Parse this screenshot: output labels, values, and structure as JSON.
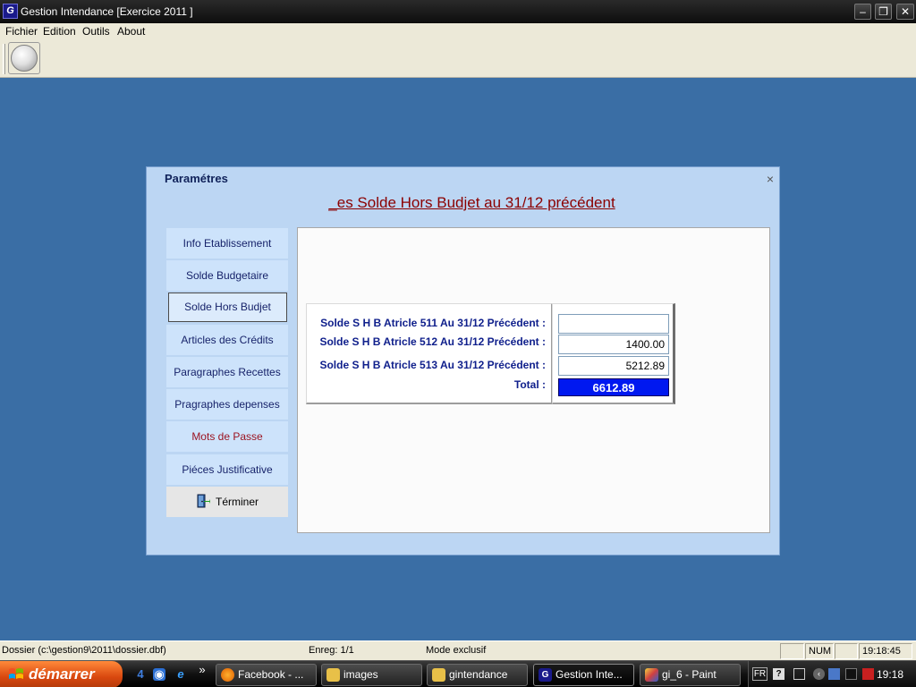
{
  "window": {
    "app_icon_letter": "G",
    "title": "Gestion Intendance [Exercice  2011 ]"
  },
  "menu": [
    "Fichier",
    "Edition",
    "Outils",
    "About"
  ],
  "dialog": {
    "title": "Paramétres",
    "close": "×",
    "heading": "_es Solde  Hors  Budjet  au 31/12   précédent",
    "nav": [
      {
        "label": "Info  Etablissement"
      },
      {
        "label": "Solde  Budgetaire"
      },
      {
        "label": "Solde  Hors  Budjet"
      },
      {
        "label": "Articles des Crédits"
      },
      {
        "label": "Paragraphes Recettes"
      },
      {
        "label": "Pragraphes  depenses"
      },
      {
        "label": "Mots de Passe"
      },
      {
        "label": "Piéces Justificative"
      },
      {
        "label": "Términer"
      }
    ],
    "active_nav": "Solde  Hors  Budjet",
    "fields": [
      {
        "label": "Solde S H B Atricle 511  Au 31/12 Précédent :",
        "value": ""
      },
      {
        "label": "Solde S H B Atricle 512  Au 31/12 Précédent :",
        "value": "1400.00"
      },
      {
        "label": "Solde S H B Atricle 513  Au 31/12 Précédent :",
        "value": "5212.89"
      }
    ],
    "total": {
      "label": "Total  :",
      "value": "6612.89"
    }
  },
  "statusbar": {
    "path": "Dossier (c:\\gestion9\\2011\\dossier.dbf)",
    "record": "Enreg: 1/1",
    "mode": "Mode exclusif",
    "num": "NUM",
    "time": "19:18:45"
  },
  "taskbar": {
    "start": "démarrer",
    "chevron": "»",
    "tasks": [
      "Facebook - ...",
      "images",
      "gintendance",
      "Gestion Inte...",
      "gi_6 - Paint"
    ],
    "lang": "FR",
    "clock": "19:18"
  },
  "colors": {
    "desktop": "#3a6ea5",
    "dialog_bg": "#bcd6f3",
    "label_blue": "#10208c",
    "heading_red": "#8b0000",
    "total_bg": "#0018f0"
  }
}
